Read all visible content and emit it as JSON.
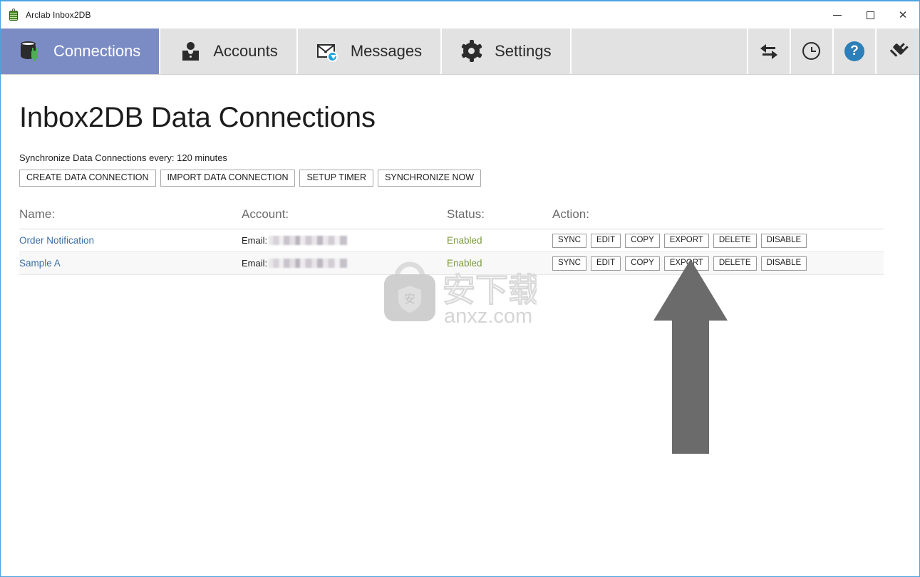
{
  "window": {
    "title": "Arclab Inbox2DB",
    "app_icon": "database-icon",
    "controls": {
      "minimize": "minimize-icon",
      "maximize": "maximize-icon",
      "close": "close-icon"
    }
  },
  "ribbon": {
    "tabs": [
      {
        "label": "Connections",
        "icon": "database-plug-icon",
        "active": true
      },
      {
        "label": "Accounts",
        "icon": "person-icon",
        "active": false
      },
      {
        "label": "Messages",
        "icon": "envelope-download-icon",
        "active": false
      },
      {
        "label": "Settings",
        "icon": "gear-icon",
        "active": false
      }
    ],
    "tools": [
      {
        "name": "sync-arrows-icon"
      },
      {
        "name": "clock-icon"
      },
      {
        "name": "help-icon",
        "glyph": "?"
      },
      {
        "name": "plug-icon"
      }
    ]
  },
  "main": {
    "page_title": "Inbox2DB Data Connections",
    "sync_note": "Synchronize Data Connections every: 120 minutes",
    "toolbar_buttons": [
      "CREATE DATA CONNECTION",
      "IMPORT DATA CONNECTION",
      "SETUP TIMER",
      "SYNCHRONIZE NOW"
    ],
    "table": {
      "columns": [
        "Name:",
        "Account:",
        "Status:",
        "Action:"
      ],
      "account_prefix": "Email:",
      "row_actions": [
        "SYNC",
        "EDIT",
        "COPY",
        "EXPORT",
        "DELETE",
        "DISABLE"
      ],
      "rows": [
        {
          "name": "Order Notification",
          "account": "Email:",
          "account_value": "",
          "status": "Enabled"
        },
        {
          "name": "Sample A",
          "account": "Email:",
          "account_value": "",
          "status": "Enabled"
        }
      ]
    }
  },
  "watermark": {
    "site": "anxz.com",
    "cjk": "安下载",
    "badge_char": "安"
  },
  "annotation": {
    "arrow": "up-arrow-annotation",
    "points_at": "EXPORT"
  },
  "colors": {
    "active_tab": "#7b8cc4",
    "ribbon": "#e2e2e2",
    "link": "#3a6ea5",
    "status_enabled": "#7a9a3c",
    "window_border": "#4aa3df",
    "arrow": "#6b6b6b",
    "watermark": "#dcdcdc",
    "help_badge": "#2c7fb8"
  }
}
